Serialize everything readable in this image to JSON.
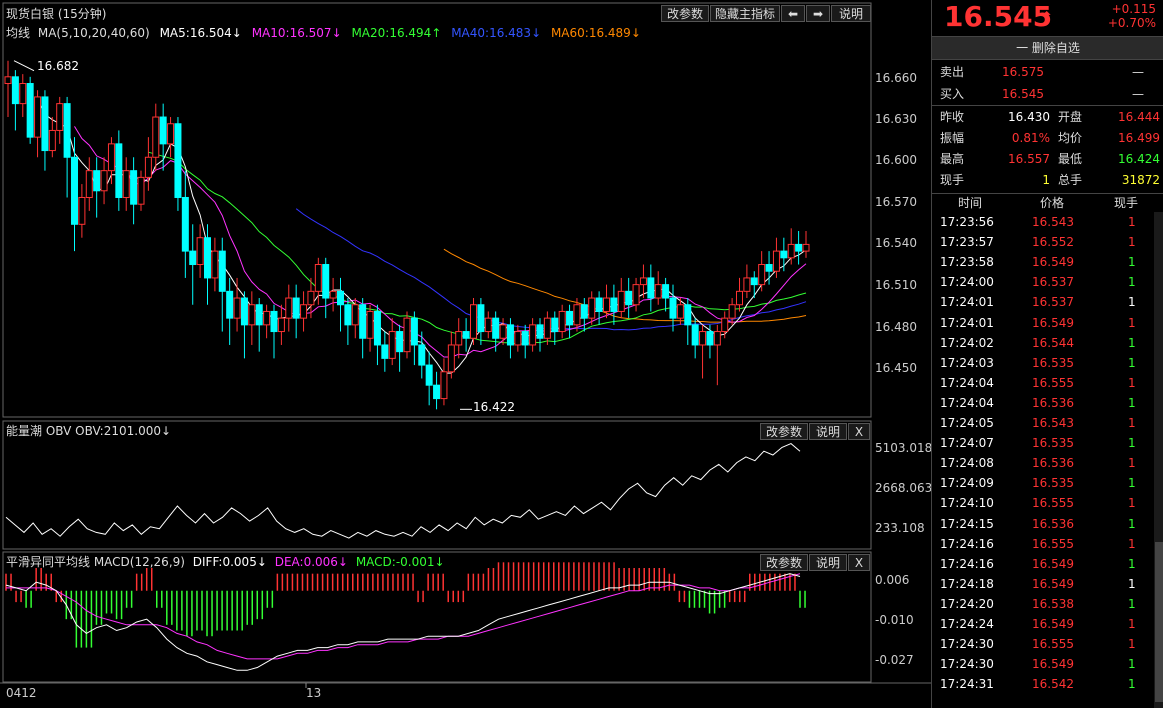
{
  "colors": {
    "up": "#ff3333",
    "down": "#00ffff",
    "ma5": "#ffffff",
    "ma10": "#ff33ff",
    "ma20": "#33ff33",
    "ma40": "#3333ff",
    "ma60": "#ff8800",
    "obv": "#ffffff",
    "diff": "#ffffff",
    "dea": "#ff33ff",
    "bar_pos": "#ff3333",
    "bar_neg": "#33ff33"
  },
  "main": {
    "title": "现货白银 (15分钟)",
    "buttons": {
      "params": "改参数",
      "hide_indicator": "隐藏主指标",
      "prev": "⬅",
      "next": "➡",
      "help": "说明"
    },
    "ma_legend": {
      "label": "均线",
      "ma5_name": "MA(5,10,20,40,60)",
      "ma5": "MA5:16.504↓",
      "ma10": "MA10:16.507↓",
      "ma20": "MA20:16.494↑",
      "ma40": "MA40:16.483↓",
      "ma60": "MA60:16.489↓"
    },
    "y_ticks": [
      "16.660",
      "16.630",
      "16.600",
      "16.570",
      "16.540",
      "16.510",
      "16.480",
      "16.450"
    ],
    "high_label": "16.682",
    "low_label": "16.422"
  },
  "obv": {
    "title": "能量潮 OBV OBV:2101.000↓",
    "buttons": {
      "params": "改参数",
      "help": "说明",
      "close": "X"
    },
    "y_ticks": [
      "5103.018",
      "2668.063",
      "233.108"
    ]
  },
  "macd": {
    "title": "平滑异同平均线 MACD(12,26,9)",
    "diff": "DIFF:0.005↓",
    "dea": "DEA:0.006↓",
    "macd": "MACD:-0.001↓",
    "buttons": {
      "params": "改参数",
      "help": "说明",
      "close": "X"
    },
    "y_ticks": [
      "0.006",
      "-0.010",
      "-0.027"
    ]
  },
  "x_axis": {
    "labels": [
      "0412",
      "13"
    ]
  },
  "quote": {
    "price": "16.545",
    "arrow": "⬆",
    "change": "+0.115",
    "change_pct": "+0.70%",
    "watch_button": "一 删除自选",
    "sell_label": "卖出",
    "sell_price": "16.575",
    "sell_vol": "—",
    "buy_label": "买入",
    "buy_price": "16.545",
    "buy_vol": "—",
    "stats": [
      {
        "l1": "昨收",
        "v1": "16.430",
        "c1": "white",
        "l2": "开盘",
        "v2": "16.444",
        "c2": "red"
      },
      {
        "l1": "振幅",
        "v1": "0.81%",
        "c1": "red",
        "l2": "均价",
        "v2": "16.499",
        "c2": "red"
      },
      {
        "l1": "最高",
        "v1": "16.557",
        "c1": "red",
        "l2": "最低",
        "v2": "16.424",
        "c2": "green"
      },
      {
        "l1": "现手",
        "v1": "1",
        "c1": "yellow",
        "l2": "总手",
        "v2": "31872",
        "c2": "yellow"
      }
    ],
    "tick_headers": [
      "时间",
      "价格",
      "现手"
    ],
    "ticks": [
      {
        "t": "17:23:56",
        "p": "16.543",
        "v": "1",
        "vc": "red"
      },
      {
        "t": "17:23:57",
        "p": "16.552",
        "v": "1",
        "vc": "red"
      },
      {
        "t": "17:23:58",
        "p": "16.549",
        "v": "1",
        "vc": "green"
      },
      {
        "t": "17:24:00",
        "p": "16.537",
        "v": "1",
        "vc": "green"
      },
      {
        "t": "17:24:01",
        "p": "16.537",
        "v": "1",
        "vc": "white"
      },
      {
        "t": "17:24:01",
        "p": "16.549",
        "v": "1",
        "vc": "red"
      },
      {
        "t": "17:24:02",
        "p": "16.544",
        "v": "1",
        "vc": "green"
      },
      {
        "t": "17:24:03",
        "p": "16.535",
        "v": "1",
        "vc": "green"
      },
      {
        "t": "17:24:04",
        "p": "16.555",
        "v": "1",
        "vc": "red"
      },
      {
        "t": "17:24:04",
        "p": "16.536",
        "v": "1",
        "vc": "green"
      },
      {
        "t": "17:24:05",
        "p": "16.543",
        "v": "1",
        "vc": "red"
      },
      {
        "t": "17:24:07",
        "p": "16.535",
        "v": "1",
        "vc": "green"
      },
      {
        "t": "17:24:08",
        "p": "16.536",
        "v": "1",
        "vc": "red"
      },
      {
        "t": "17:24:09",
        "p": "16.535",
        "v": "1",
        "vc": "green"
      },
      {
        "t": "17:24:10",
        "p": "16.555",
        "v": "1",
        "vc": "red"
      },
      {
        "t": "17:24:15",
        "p": "16.536",
        "v": "1",
        "vc": "green"
      },
      {
        "t": "17:24:16",
        "p": "16.555",
        "v": "1",
        "vc": "red"
      },
      {
        "t": "17:24:16",
        "p": "16.549",
        "v": "1",
        "vc": "green"
      },
      {
        "t": "17:24:18",
        "p": "16.549",
        "v": "1",
        "vc": "white"
      },
      {
        "t": "17:24:20",
        "p": "16.538",
        "v": "1",
        "vc": "green"
      },
      {
        "t": "17:24:24",
        "p": "16.549",
        "v": "1",
        "vc": "red"
      },
      {
        "t": "17:24:30",
        "p": "16.555",
        "v": "1",
        "vc": "red"
      },
      {
        "t": "17:24:30",
        "p": "16.549",
        "v": "1",
        "vc": "green"
      },
      {
        "t": "17:24:31",
        "p": "16.542",
        "v": "1",
        "vc": "green"
      }
    ]
  },
  "chart_data": {
    "type": "candlestick",
    "price_range": [
      16.42,
      16.69
    ],
    "candles": [
      [
        16.665,
        16.67,
        16.64,
        16.682
      ],
      [
        16.67,
        16.65,
        16.63,
        16.675
      ],
      [
        16.65,
        16.665,
        16.64,
        16.672
      ],
      [
        16.665,
        16.625,
        16.62,
        16.67
      ],
      [
        16.625,
        16.655,
        16.61,
        16.66
      ],
      [
        16.655,
        16.615,
        16.6,
        16.66
      ],
      [
        16.615,
        16.63,
        16.61,
        16.64
      ],
      [
        16.63,
        16.65,
        16.62,
        16.655
      ],
      [
        16.65,
        16.61,
        16.58,
        16.655
      ],
      [
        16.61,
        16.56,
        16.54,
        16.625
      ],
      [
        16.56,
        16.58,
        16.55,
        16.59
      ],
      [
        16.58,
        16.6,
        16.57,
        16.61
      ],
      [
        16.6,
        16.585,
        16.565,
        16.61
      ],
      [
        16.585,
        16.6,
        16.575,
        16.61
      ],
      [
        16.6,
        16.62,
        16.59,
        16.625
      ],
      [
        16.62,
        16.58,
        16.57,
        16.63
      ],
      [
        16.58,
        16.6,
        16.57,
        16.61
      ],
      [
        16.6,
        16.575,
        16.56,
        16.61
      ],
      [
        16.575,
        16.595,
        16.57,
        16.6
      ],
      [
        16.595,
        16.61,
        16.585,
        16.625
      ],
      [
        16.61,
        16.64,
        16.6,
        16.65
      ],
      [
        16.64,
        16.62,
        16.6,
        16.65
      ],
      [
        16.62,
        16.635,
        16.61,
        16.64
      ],
      [
        16.635,
        16.58,
        16.57,
        16.64
      ],
      [
        16.58,
        16.54,
        16.52,
        16.6
      ],
      [
        16.54,
        16.53,
        16.5,
        16.56
      ],
      [
        16.53,
        16.55,
        16.52,
        16.56
      ],
      [
        16.55,
        16.52,
        16.5,
        16.56
      ],
      [
        16.52,
        16.54,
        16.51,
        16.55
      ],
      [
        16.54,
        16.51,
        16.48,
        16.55
      ],
      [
        16.51,
        16.49,
        16.47,
        16.52
      ],
      [
        16.49,
        16.505,
        16.48,
        16.52
      ],
      [
        16.505,
        16.485,
        16.46,
        16.51
      ],
      [
        16.485,
        16.5,
        16.47,
        16.51
      ],
      [
        16.5,
        16.485,
        16.465,
        16.505
      ],
      [
        16.485,
        16.495,
        16.475,
        16.5
      ],
      [
        16.495,
        16.48,
        16.46,
        16.5
      ],
      [
        16.48,
        16.49,
        16.47,
        16.5
      ],
      [
        16.49,
        16.505,
        16.48,
        16.515
      ],
      [
        16.505,
        16.49,
        16.475,
        16.515
      ],
      [
        16.49,
        16.5,
        16.48,
        16.51
      ],
      [
        16.5,
        16.51,
        16.49,
        16.52
      ],
      [
        16.51,
        16.53,
        16.5,
        16.535
      ],
      [
        16.53,
        16.505,
        16.49,
        16.535
      ],
      [
        16.505,
        16.51,
        16.495,
        16.52
      ],
      [
        16.51,
        16.5,
        16.48,
        16.52
      ],
      [
        16.5,
        16.485,
        16.47,
        16.505
      ],
      [
        16.485,
        16.5,
        16.475,
        16.505
      ],
      [
        16.5,
        16.475,
        16.46,
        16.505
      ],
      [
        16.475,
        16.495,
        16.465,
        16.5
      ],
      [
        16.495,
        16.47,
        16.455,
        16.5
      ],
      [
        16.47,
        16.46,
        16.45,
        16.48
      ],
      [
        16.46,
        16.48,
        16.455,
        16.49
      ],
      [
        16.48,
        16.465,
        16.45,
        16.485
      ],
      [
        16.465,
        16.49,
        16.46,
        16.495
      ],
      [
        16.49,
        16.47,
        16.455,
        16.495
      ],
      [
        16.47,
        16.455,
        16.445,
        16.48
      ],
      [
        16.455,
        16.44,
        16.425,
        16.465
      ],
      [
        16.44,
        16.43,
        16.422,
        16.45
      ],
      [
        16.43,
        16.45,
        16.425,
        16.46
      ],
      [
        16.45,
        16.47,
        16.445,
        16.48
      ],
      [
        16.47,
        16.48,
        16.46,
        16.49
      ],
      [
        16.48,
        16.475,
        16.465,
        16.49
      ],
      [
        16.475,
        16.5,
        16.47,
        16.505
      ],
      [
        16.5,
        16.48,
        16.47,
        16.505
      ],
      [
        16.48,
        16.49,
        16.475,
        16.495
      ],
      [
        16.49,
        16.475,
        16.465,
        16.495
      ],
      [
        16.475,
        16.485,
        16.47,
        16.49
      ],
      [
        16.485,
        16.47,
        16.46,
        16.49
      ],
      [
        16.47,
        16.48,
        16.465,
        16.485
      ],
      [
        16.48,
        16.47,
        16.46,
        16.485
      ],
      [
        16.47,
        16.485,
        16.465,
        16.49
      ],
      [
        16.485,
        16.475,
        16.465,
        16.49
      ],
      [
        16.475,
        16.49,
        16.47,
        16.495
      ],
      [
        16.49,
        16.48,
        16.47,
        16.495
      ],
      [
        16.48,
        16.495,
        16.475,
        16.5
      ],
      [
        16.495,
        16.485,
        16.475,
        16.5
      ],
      [
        16.485,
        16.5,
        16.48,
        16.505
      ],
      [
        16.5,
        16.49,
        16.48,
        16.505
      ],
      [
        16.49,
        16.505,
        16.485,
        16.51
      ],
      [
        16.505,
        16.495,
        16.485,
        16.51
      ],
      [
        16.495,
        16.505,
        16.49,
        16.515
      ],
      [
        16.505,
        16.495,
        16.485,
        16.515
      ],
      [
        16.495,
        16.51,
        16.49,
        16.52
      ],
      [
        16.51,
        16.5,
        16.49,
        16.52
      ],
      [
        16.5,
        16.515,
        16.495,
        16.52
      ],
      [
        16.515,
        16.52,
        16.505,
        16.53
      ],
      [
        16.52,
        16.505,
        16.495,
        16.53
      ],
      [
        16.505,
        16.515,
        16.5,
        16.525
      ],
      [
        16.515,
        16.505,
        16.495,
        16.52
      ],
      [
        16.505,
        16.49,
        16.48,
        16.515
      ],
      [
        16.49,
        16.5,
        16.485,
        16.505
      ],
      [
        16.5,
        16.485,
        16.47,
        16.505
      ],
      [
        16.485,
        16.47,
        16.46,
        16.49
      ],
      [
        16.47,
        16.48,
        16.445,
        16.485
      ],
      [
        16.48,
        16.47,
        16.46,
        16.485
      ],
      [
        16.47,
        16.48,
        16.44,
        16.485
      ],
      [
        16.48,
        16.49,
        16.475,
        16.495
      ],
      [
        16.49,
        16.5,
        16.485,
        16.505
      ],
      [
        16.5,
        16.51,
        16.495,
        16.52
      ],
      [
        16.51,
        16.52,
        16.505,
        16.53
      ],
      [
        16.52,
        16.515,
        16.505,
        16.525
      ],
      [
        16.515,
        16.53,
        16.51,
        16.54
      ],
      [
        16.53,
        16.525,
        16.515,
        16.54
      ],
      [
        16.525,
        16.54,
        16.52,
        16.55
      ],
      [
        16.54,
        16.535,
        16.525,
        16.55
      ],
      [
        16.535,
        16.545,
        16.53,
        16.557
      ],
      [
        16.545,
        16.54,
        16.53,
        16.555
      ],
      [
        16.54,
        16.545,
        16.535,
        16.555
      ]
    ],
    "obv": [
      1200,
      800,
      400,
      900,
      300,
      600,
      200,
      700,
      1100,
      600,
      400,
      300,
      900,
      500,
      800,
      300,
      700,
      600,
      1200,
      1800,
      1300,
      900,
      1400,
      900,
      1200,
      1700,
      1400,
      1000,
      1300,
      1700,
      1000,
      600,
      400,
      600,
      300,
      200,
      500,
      300,
      100,
      400,
      200,
      500,
      300,
      200,
      400,
      200,
      700,
      400,
      800,
      500,
      900,
      600,
      1200,
      800,
      1100,
      900,
      1300,
      1200,
      1600,
      1100,
      1300,
      1500,
      1300,
      1800,
      1400,
      1700,
      2000,
      1600,
      2200,
      2700,
      3000,
      2500,
      2300,
      2900,
      3300,
      2900,
      3400,
      3200,
      3700,
      4000,
      3600,
      4100,
      4400,
      4200,
      4700,
      4500,
      4900,
      5103,
      4700
    ],
    "diff": [
      0.002,
      0.001,
      0.0,
      0.003,
      0.002,
      0.0,
      -0.005,
      -0.012,
      -0.015,
      -0.013,
      -0.012,
      -0.014,
      -0.013,
      -0.011,
      -0.01,
      -0.013,
      -0.017,
      -0.02,
      -0.022,
      -0.023,
      -0.025,
      -0.026,
      -0.027,
      -0.028,
      -0.028,
      -0.027,
      -0.025,
      -0.023,
      -0.022,
      -0.021,
      -0.021,
      -0.02,
      -0.02,
      -0.019,
      -0.019,
      -0.018,
      -0.018,
      -0.018,
      -0.017,
      -0.017,
      -0.017,
      -0.017,
      -0.016,
      -0.016,
      -0.016,
      -0.016,
      -0.015,
      -0.014,
      -0.012,
      -0.01,
      -0.009,
      -0.008,
      -0.007,
      -0.006,
      -0.005,
      -0.004,
      -0.003,
      -0.002,
      -0.001,
      0.0,
      0.001,
      0.001,
      0.002,
      0.002,
      0.003,
      0.003,
      0.003,
      0.002,
      0.001,
      0.0,
      -0.001,
      -0.001,
      0.0,
      0.001,
      0.002,
      0.003,
      0.004,
      0.005,
      0.006,
      0.005
    ],
    "dea": [
      0.001,
      0.001,
      0.001,
      0.001,
      0.001,
      0.0,
      -0.002,
      -0.004,
      -0.007,
      -0.009,
      -0.01,
      -0.011,
      -0.012,
      -0.012,
      -0.012,
      -0.012,
      -0.013,
      -0.015,
      -0.016,
      -0.018,
      -0.019,
      -0.021,
      -0.022,
      -0.023,
      -0.024,
      -0.024,
      -0.024,
      -0.024,
      -0.023,
      -0.022,
      -0.022,
      -0.021,
      -0.021,
      -0.02,
      -0.02,
      -0.019,
      -0.019,
      -0.019,
      -0.018,
      -0.018,
      -0.018,
      -0.017,
      -0.017,
      -0.017,
      -0.016,
      -0.016,
      -0.016,
      -0.015,
      -0.014,
      -0.013,
      -0.012,
      -0.011,
      -0.01,
      -0.009,
      -0.008,
      -0.007,
      -0.006,
      -0.005,
      -0.004,
      -0.003,
      -0.002,
      -0.001,
      0.0,
      0.0,
      0.001,
      0.001,
      0.002,
      0.002,
      0.002,
      0.001,
      0.001,
      0.0,
      0.0,
      0.001,
      0.001,
      0.002,
      0.003,
      0.004,
      0.005,
      0.006
    ],
    "macd_range": [
      -0.03,
      0.008
    ]
  }
}
